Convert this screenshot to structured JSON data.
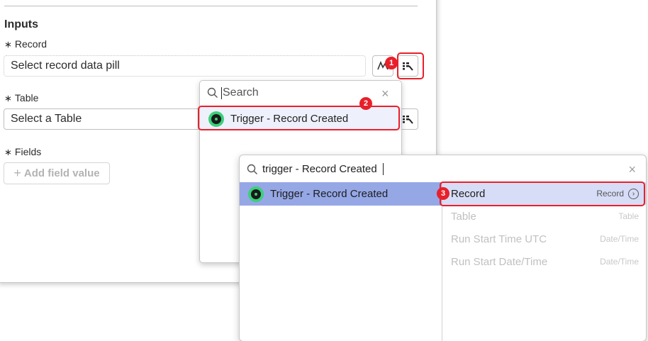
{
  "form": {
    "section_title": "Inputs",
    "record": {
      "label": "Record",
      "required_mark": "∗",
      "placeholder": "Select record data pill"
    },
    "table": {
      "label": "Table",
      "required_mark": "∗",
      "placeholder": "Select a Table"
    },
    "fields": {
      "label": "Fields",
      "required_mark": "∗",
      "add_button": "Add field value",
      "add_symbol": "+"
    }
  },
  "dropdown1": {
    "search_placeholder": "Search",
    "item": "Trigger - Record Created"
  },
  "dropdown2": {
    "search_value": "trigger - Record Created",
    "left_item": "Trigger - Record Created",
    "options": [
      {
        "name": "Record",
        "type": "Record",
        "state": "active"
      },
      {
        "name": "Table",
        "type": "Table",
        "state": "disabled"
      },
      {
        "name": "Run Start Time UTC",
        "type": "Date/Time",
        "state": "disabled"
      },
      {
        "name": "Run Start Date/Time",
        "type": "Date/Time",
        "state": "disabled"
      }
    ]
  },
  "callouts": {
    "c1": "1",
    "c2": "2",
    "c3": "3"
  },
  "colors": {
    "callout": "#e8202a",
    "selected_left": "#96a7e6",
    "selected_row": "#d7ddf7",
    "trigger_icon": "#3bd07a"
  },
  "icons": [
    "search-icon",
    "close-icon",
    "data-pill-picker-icon",
    "dynamic-data-icon",
    "trigger-icon",
    "chevron-right-circle-icon",
    "plus-icon"
  ]
}
